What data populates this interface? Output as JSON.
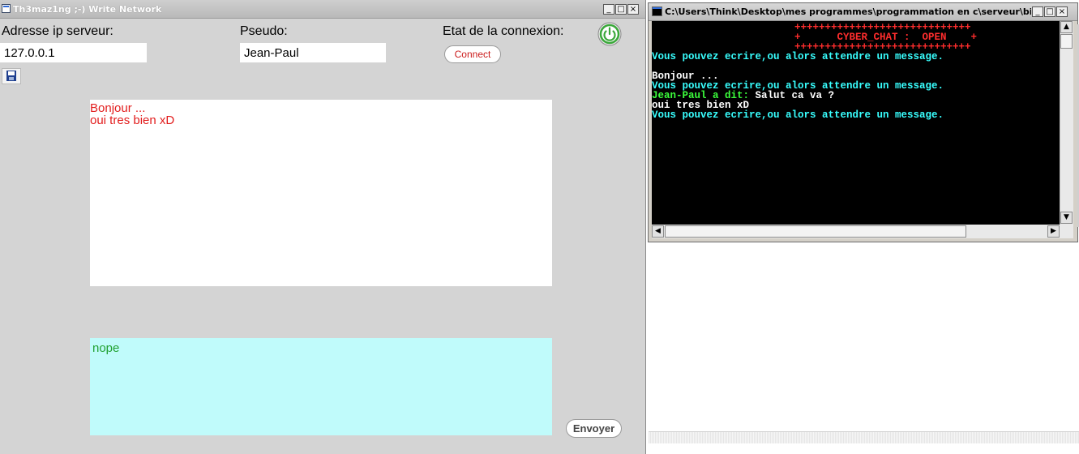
{
  "write_network": {
    "title": "Th3maz1ng ;-) Write Network",
    "labels": {
      "server_ip": "Adresse ip serveur:",
      "nickname": "Pseudo:",
      "connection_state": "Etat de la connexion:"
    },
    "fields": {
      "server_ip": "127.0.0.1",
      "nickname": "Jean-Paul"
    },
    "connect_button": "Connect",
    "chat_log": [
      "Bonjour ...",
      "oui tres bien xD"
    ],
    "compose_text": "nope",
    "send_button": "Envoyer",
    "icons": {
      "power": "power-icon",
      "save": "floppy-disk-icon",
      "app": "window-app-icon"
    },
    "colors": {
      "log_text": "#e21d1d",
      "compose_bg": "#c0fbfb",
      "compose_text": "#21a132",
      "power_ring": "#3aa83a",
      "connect_text": "#cc1d1d"
    }
  },
  "console": {
    "title": "C:\\Users\\Think\\Desktop\\mes programmes\\programmation en c\\serveur\\bin...",
    "banner_border": "+++++++++++++++++++++++++++++",
    "banner_text": "+      CYBER_CHAT :  OPEN    +",
    "lines": [
      {
        "text": "Vous pouvez ecrire,ou alors attendre un message.",
        "color": "cyan"
      },
      {
        "text": "",
        "color": "white"
      },
      {
        "text": "Bonjour ...",
        "color": "white"
      },
      {
        "text": "Vous pouvez ecrire,ou alors attendre un message.",
        "color": "cyan"
      },
      {
        "speaker": "Jean-Paul a dit:",
        "message": " Salut ca va ?",
        "color": "green"
      },
      {
        "text": "oui tres bien xD",
        "color": "white"
      },
      {
        "text": "Vous pouvez ecrire,ou alors attendre un message.",
        "color": "cyan"
      }
    ],
    "colors": {
      "background": "#000000",
      "banner": "#ff2d2d",
      "info": "#38ffff",
      "text": "#ffffff",
      "speaker": "#3cff3c"
    }
  }
}
